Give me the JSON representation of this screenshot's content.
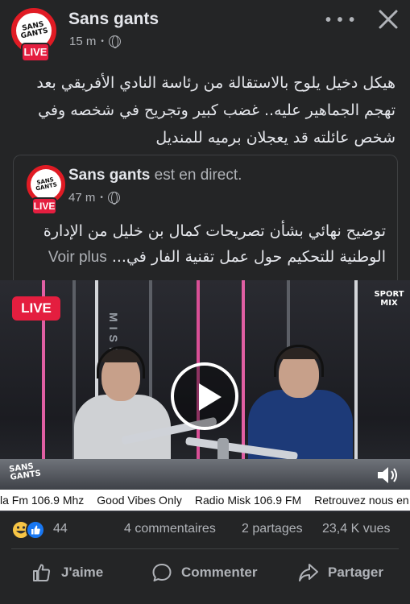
{
  "post": {
    "page_name": "Sans gants",
    "time": "15 m",
    "live_label": "LIVE",
    "avatar_text": "SANS GANTS",
    "caption": "هيكل دخيل يلوح بالاستقالة من رئاسة النادي الأفريقي بعد تهجم الجماهير عليه.. غضب كبير وتجريح في شخصه وفي شخص عائلته قد يعجلان برميه للمنديل"
  },
  "shared": {
    "page_name": "Sans gants",
    "suffix": "est en direct.",
    "time": "47 m",
    "live_label": "LIVE",
    "text": "توضيح نهائي بشأن تصريحات كمال بن خليل من الإدارة الوطنية للتحكيم حول عمل تقنية الفار في...",
    "see_more": "Voir plus"
  },
  "video": {
    "live_label": "LIVE",
    "channel_logo": "SPORT MIX",
    "studio_text": "MISK",
    "watermark": "SANS GANTS",
    "ticker": [
      "la Fm 106.9 Mhz",
      "Good Vibes Only",
      "Radio Misk 106.9 FM",
      "Retrouvez nous en"
    ]
  },
  "stats": {
    "reactions_count": "44",
    "comments": "4 commentaires",
    "shares": "2 partages",
    "views": "23,4 K vues"
  },
  "actions": {
    "like": "J'aime",
    "comment": "Commenter",
    "share": "Partager"
  },
  "icons": {
    "more": "more-horizontal-icon",
    "close": "close-icon",
    "privacy": "globe-icon",
    "play": "play-icon",
    "sound": "speaker-icon"
  },
  "colors": {
    "background": "#242526",
    "live_red": "#e41e3f",
    "text_primary": "#e4e6eb",
    "text_secondary": "#b0b3b8",
    "like_blue": "#1877f2"
  }
}
